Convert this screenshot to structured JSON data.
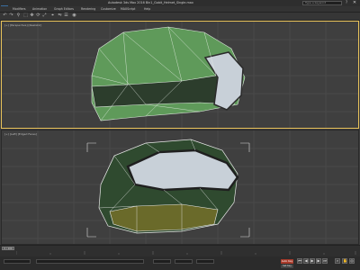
{
  "app": {
    "title": "Autodesk 3ds Max 2016   Bin1_Gobit_Helmet_Single.max",
    "search_placeholder": "Type a keyword",
    "help_label": "?",
    "close_label": "✕"
  },
  "menu": {
    "items": [
      "Modifiers",
      "Animation",
      "Graph Editors",
      "Rendering",
      "Customize",
      "MAXScript",
      "Help"
    ]
  },
  "toolbar": {
    "icons": [
      "undo-icon",
      "redo-icon",
      "link-icon",
      "select-icon",
      "move-icon",
      "rotate-icon",
      "scale-icon",
      "snap-icon",
      "mirror-icon",
      "align-icon",
      "render-icon"
    ]
  },
  "viewports": {
    "top_label": "[+] [Perspective] [Realistic]",
    "bottom_label": "[+] [Left] [Edged Faces]"
  },
  "timeline": {
    "frame_label": "0 / 100"
  },
  "status": {
    "autokey_label": "Auto Key",
    "setkey_label": "Set Key",
    "selected_label": "Selected"
  },
  "colors": {
    "helmet_green": "#5f9a5a",
    "helmet_dark": "#2a3a2a",
    "goggle_glass": "#c8d0d8",
    "wire": "#e8e8e8",
    "viewport_border_active": "#e8c25a",
    "autokey": "#a83a2a"
  }
}
